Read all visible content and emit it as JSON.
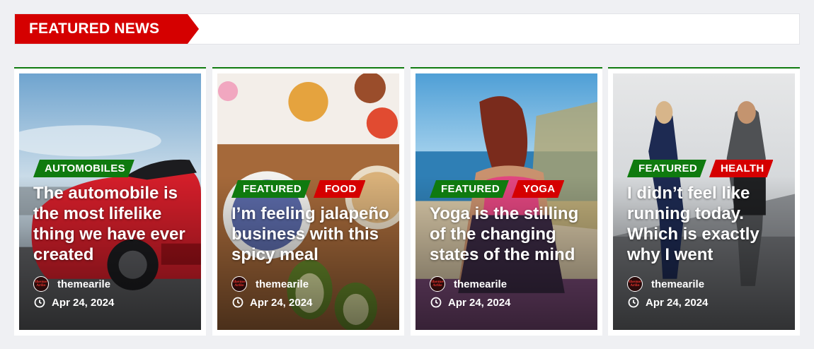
{
  "section": {
    "title": "FEATURED NEWS"
  },
  "posts": [
    {
      "tags": [
        {
          "label": "AUTOMOBILES",
          "color": "#0f7a0f"
        }
      ],
      "title": "The automobile is the most lifelike thing we have ever created",
      "author": "themearile",
      "date": "Apr 24, 2024"
    },
    {
      "tags": [
        {
          "label": "FEATURED",
          "color": "#0f7a0f"
        },
        {
          "label": "FOOD",
          "color": "#d50000"
        }
      ],
      "title": "I’m feeling jalapeño business with this spicy meal",
      "author": "themearile",
      "date": "Apr 24, 2024"
    },
    {
      "tags": [
        {
          "label": "FEATURED",
          "color": "#0f7a0f"
        },
        {
          "label": "YOGA",
          "color": "#d50000"
        }
      ],
      "title": "Yoga is the stilling of the changing states of the mind",
      "author": "themearile",
      "date": "Apr 24, 2024"
    },
    {
      "tags": [
        {
          "label": "FEATURED",
          "color": "#0f7a0f"
        },
        {
          "label": "HEALTH",
          "color": "#d50000"
        }
      ],
      "title": "I didn’t feel like running today. Which is exactly why I went",
      "author": "themearile",
      "date": "Apr 24, 2024"
    }
  ],
  "avatar_logo": {
    "line1": "theme",
    "line2": "Arile"
  },
  "colors": {
    "accent_red": "#d50000",
    "accent_green": "#0f7a0f",
    "page_bg": "#eff0f3"
  }
}
